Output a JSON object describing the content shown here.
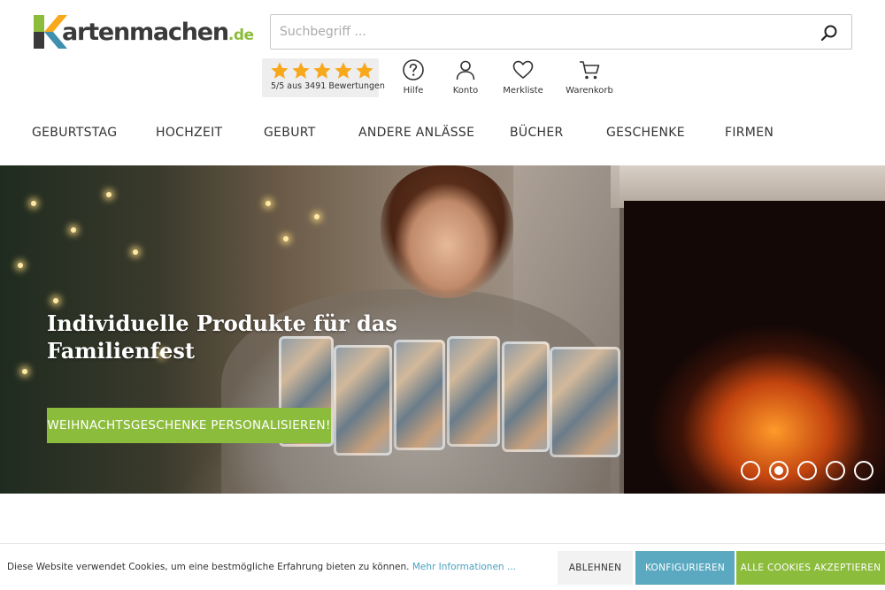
{
  "brand": {
    "name": "artenmachen",
    "tld": ".de",
    "accent": "#8cbc3c",
    "info_link_color": "#4aa0c0"
  },
  "search": {
    "placeholder": "Suchbegriff ...",
    "value": "",
    "icon": "search-icon"
  },
  "rating": {
    "stars": 5,
    "stars_color": "#f7a81b",
    "text": "5/5 aus 3491 Bewertungen"
  },
  "services": [
    {
      "label": "Hilfe",
      "icon": "help-icon"
    },
    {
      "label": "Konto",
      "icon": "user-icon"
    },
    {
      "label": "Merkliste",
      "icon": "heart-icon"
    },
    {
      "label": "Warenkorb",
      "icon": "cart-icon"
    }
  ],
  "nav": [
    {
      "label": "GEBURTSTAG"
    },
    {
      "label": "HOCHZEIT"
    },
    {
      "label": "GEBURT"
    },
    {
      "label": "ANDERE ANLÄSSE"
    },
    {
      "label": "BÜCHER"
    },
    {
      "label": "GESCHENKE"
    },
    {
      "label": "FIRMEN"
    }
  ],
  "hero": {
    "title_line1": "Individuelle Produkte für das",
    "title_line2": "Familienfest",
    "cta": "WEIHNACHTSGESCHENKE PERSONALISIEREN!",
    "slides": 5,
    "active_slide": 2
  },
  "cookie": {
    "text": "Diese Website verwendet Cookies, um eine bestmögliche Erfahrung bieten zu können.",
    "link": "Mehr Informationen ...",
    "decline": "ABLEHNEN",
    "configure": "KONFIGURIEREN",
    "accept": "ALLE COOKIES AKZEPTIEREN"
  }
}
